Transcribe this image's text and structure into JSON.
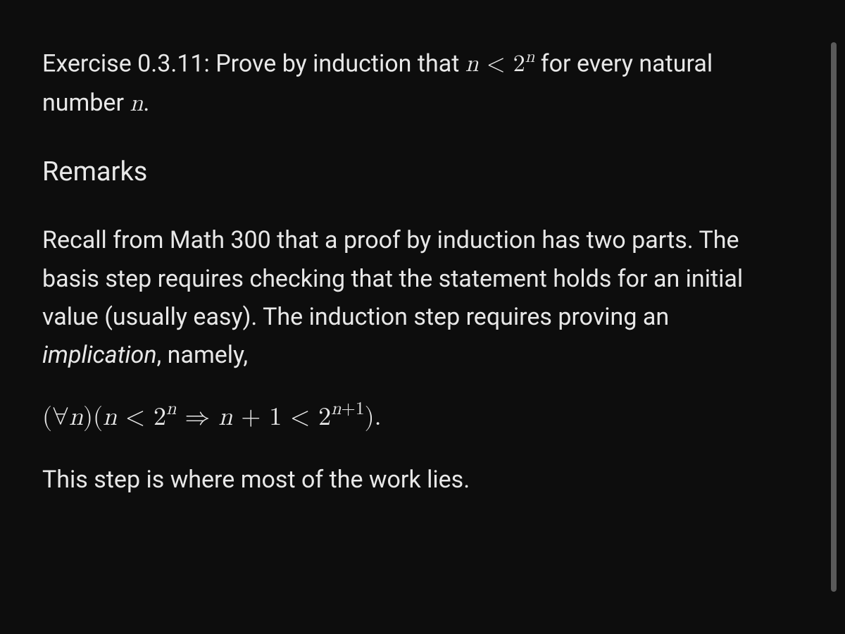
{
  "exercise": {
    "label": "Exercise 0.3.11:",
    "prompt_before_math": " Prove by induction that ",
    "math_inline_1_html": "<span class='math-inline'>n <span class='math-upright'>&lt;</span> <span class='math-upright'>2</span><span class='sup'>n</span></span>",
    "prompt_after_math": " for every natural number ",
    "math_inline_2_html": "<span class='math-inline'>n</span>",
    "prompt_end": "."
  },
  "remarks_heading": "Remarks",
  "remarks_body": {
    "p1_before": "Recall from Math 300 that a proof by induction has two parts. The basis step requires checking that the statement holds for an initial value (usually easy). The induction step requires proving an ",
    "p1_emph": "implication",
    "p1_after": ", namely,"
  },
  "math_display_html": "<span class='math-upright'>(&forall;</span>n<span class='math-upright'>)(</span>n <span class='math-upright'>&lt; 2</span><span class='sup'>n</span> <span class='math-upright'>&rArr;</span> n <span class='math-upright'>+ 1 &lt; 2</span><span class='sup'>n<span class='math-upright'>+1</span></span><span class='math-upright'>).</span>",
  "closing": "This step is where most of the work lies."
}
